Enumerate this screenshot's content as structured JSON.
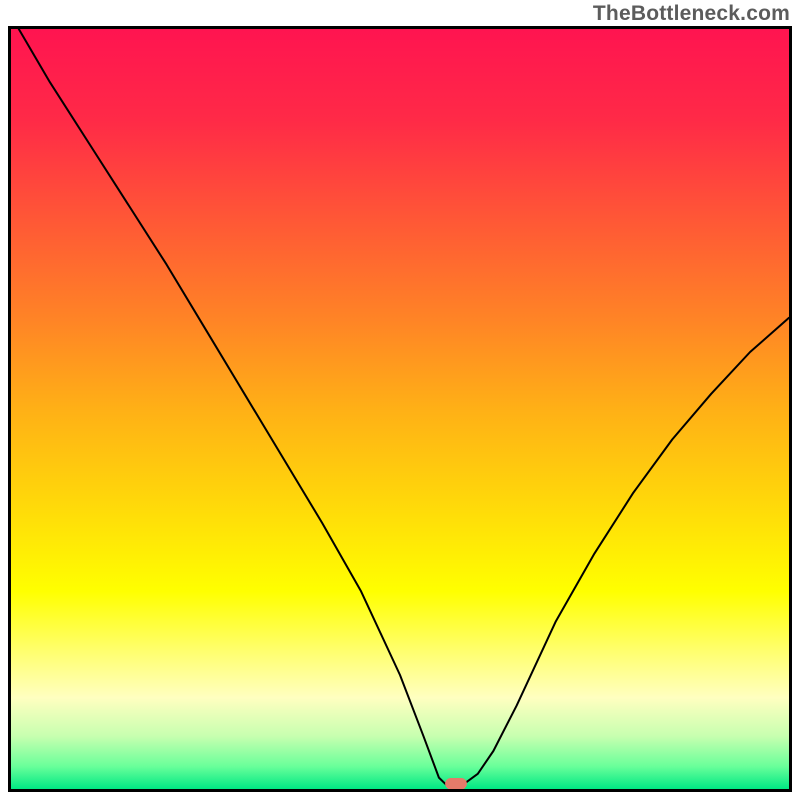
{
  "watermark": "TheBottleneck.com",
  "chart_data": {
    "type": "line",
    "title": "",
    "xlabel": "",
    "ylabel": "",
    "xlim": [
      0,
      100
    ],
    "ylim": [
      0,
      100
    ],
    "background": {
      "type": "vertical-gradient",
      "stops": [
        {
          "offset": 0.0,
          "color": "#ff1450"
        },
        {
          "offset": 0.12,
          "color": "#ff2a47"
        },
        {
          "offset": 0.25,
          "color": "#ff5736"
        },
        {
          "offset": 0.38,
          "color": "#ff8326"
        },
        {
          "offset": 0.5,
          "color": "#ffb016"
        },
        {
          "offset": 0.62,
          "color": "#ffd70a"
        },
        {
          "offset": 0.74,
          "color": "#ffff00"
        },
        {
          "offset": 0.82,
          "color": "#ffff70"
        },
        {
          "offset": 0.88,
          "color": "#ffffc0"
        },
        {
          "offset": 0.93,
          "color": "#c8ffb0"
        },
        {
          "offset": 0.97,
          "color": "#6aff9a"
        },
        {
          "offset": 1.0,
          "color": "#00e884"
        }
      ]
    },
    "series": [
      {
        "name": "bottleneck-curve",
        "color": "#000000",
        "width": 2,
        "x": [
          1,
          5,
          10,
          15,
          20,
          25,
          30,
          35,
          40,
          45,
          50,
          53,
          55,
          56,
          57,
          58,
          60,
          62,
          65,
          70,
          75,
          80,
          85,
          90,
          95,
          100
        ],
        "y": [
          100,
          93,
          85,
          77,
          69,
          60.5,
          52,
          43.5,
          35,
          26,
          15,
          7,
          1.5,
          0.5,
          0.5,
          0.5,
          2,
          5,
          11,
          22,
          31,
          39,
          46,
          52,
          57.5,
          62
        ]
      }
    ],
    "marker": {
      "name": "optimal-point",
      "shape": "rounded-rect",
      "x": 57.2,
      "y": 0.7,
      "color": "#e47b6a",
      "width_frac": 0.028,
      "height_frac": 0.015
    },
    "border": {
      "color": "#000000",
      "width": 3
    }
  }
}
